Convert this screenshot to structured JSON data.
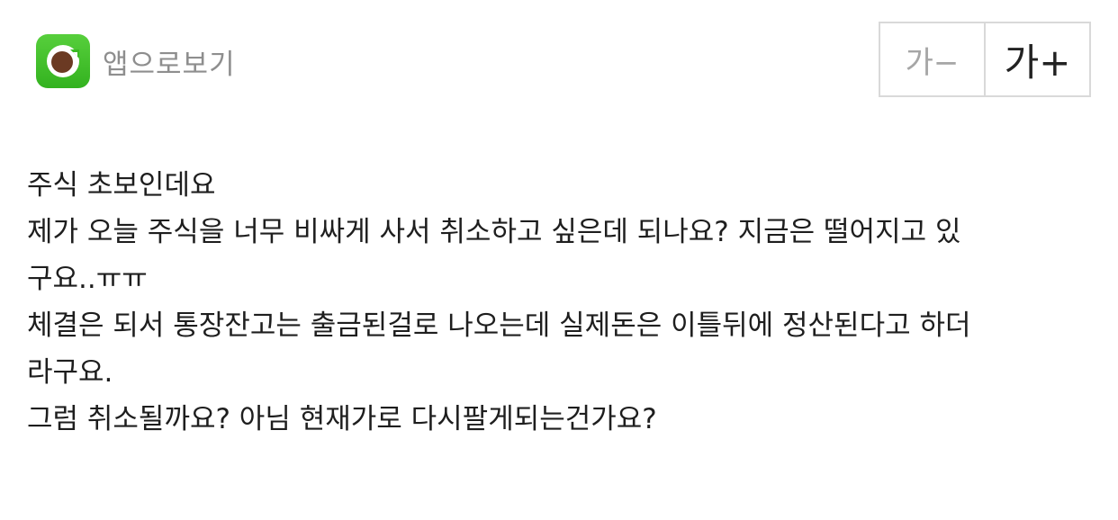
{
  "header": {
    "app_open_label": "앱으로보기",
    "font_decrease_label": "가−",
    "font_increase_label": "가+"
  },
  "post": {
    "lines": [
      "주식 초보인데요",
      "제가 오늘 주식을 너무 비싸게 사서 취소하고 싶은데 되나요? 지금은 떨어지고 있",
      "구요..ㅠㅠ",
      "체결은 되서 통장잔고는 출금된걸로 나오는데 실제돈은 이틀뒤에 정산된다고 하더",
      "라구요.",
      "그럼 취소될까요? 아님 현재가로 다시팔게되는건가요?"
    ]
  },
  "colors": {
    "app_icon_green": "#3cba24",
    "app_icon_inner": "#6b3a23",
    "label_gray": "#8e8e8e",
    "border_gray": "#d9d9d9",
    "text": "#1e1e1e"
  },
  "icons": {
    "app_icon": "app-refresh-icon"
  }
}
